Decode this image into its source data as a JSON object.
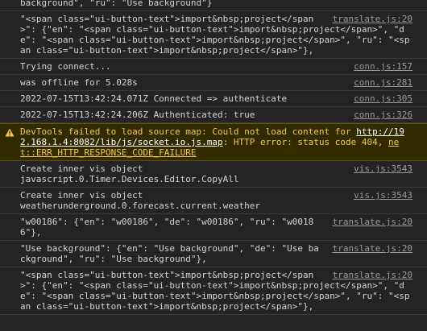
{
  "console": {
    "partial_top_text": "background\", \"ru\": \"Use background\"}",
    "entries": [
      {
        "message": "\"<span class=\"ui-button-text\">import&nbsp;project</span>\": {\"en\": \"<span class=\"ui-button-text\">import&nbsp;project</span>\", \"de\": \"<span class=\"ui-button-text\">import&nbsp;project</span>\", \"ru\": \"<span class=\"ui-button-text\">import&nbsp;project</span>\"},",
        "source": "translate.js:20"
      },
      {
        "message": "Trying connect...",
        "source": "conn.js:157"
      },
      {
        "message": "was offline for 5.028s",
        "source": "conn.js:281"
      },
      {
        "message": "2022-07-15T13:42:24.071Z Connected => authenticate",
        "source": "conn.js:305"
      },
      {
        "message": "2022-07-15T13:42:24.206Z Authenticated: true",
        "source": "conn.js:326"
      }
    ],
    "warning": {
      "text_before": "DevTools failed to load source map: Could not load content for ",
      "link": "http://192.168.1.4:8082/lib/js/socket.io.js.map",
      "text_middle": ": HTTP error: status code 404, ",
      "error_code": "net::ERR_HTTP_RESPONSE_CODE_FAILURE",
      "icon": "warning-triangle-icon",
      "color": "#f2c94c",
      "background": "#332b00"
    },
    "entries_after": [
      {
        "message": "Create inner vis object\njavascript.0.Timer.Devices.Editor.CopyAll",
        "source": "vis.js:3543"
      },
      {
        "message": "Create inner vis object\nweatherunderground.0.forecast.current.weather",
        "source": "vis.js:3543"
      },
      {
        "message": "\"w00186\": {\"en\": \"w00186\", \"de\": \"w00186\", \"ru\": \"w00186\"},",
        "source": "translate.js:20"
      },
      {
        "message": "\"Use background\": {\"en\": \"Use background\", \"de\": \"Use background\", \"ru\": \"Use background\"},",
        "source": "translate.js:20"
      },
      {
        "message": "\"<span class=\"ui-button-text\">import&nbsp;project</span>\": {\"en\": \"<span class=\"ui-button-text\">import&nbsp;project</span>\", \"de\": \"<span class=\"ui-button-text\">import&nbsp;project</span>\", \"ru\": \"<span class=\"ui-button-text\">import&nbsp;project</span>\"},",
        "source": "translate.js:20"
      }
    ]
  }
}
